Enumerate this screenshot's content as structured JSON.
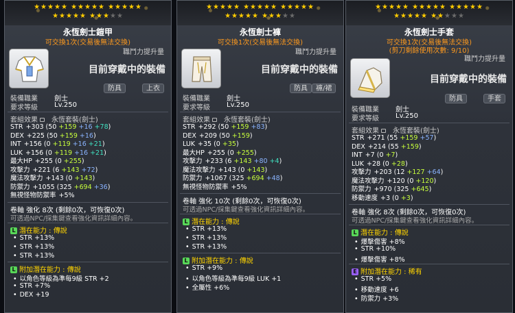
{
  "colors": {
    "tradable": "#ff9a1e",
    "starsOn": "#ffcc00",
    "green": "#c8ff3c",
    "blue": "#8ab4ff",
    "cyan": "#40e0c0",
    "legendary": "#58d858",
    "unique": "#ffcc00",
    "epic": "#9a60ff"
  },
  "items": [
    {
      "stars_row1": "★★★★★ ★★★★★ ★★★★★",
      "stars_row2": "★★★★★ ★★★",
      "stars_row2_dim": "★★",
      "title": "永恆劍士鎧甲",
      "tradable": "可交換1次(交易後無法交換)",
      "tradable2": "",
      "upgrade": "職鬥力提升量",
      "equipped": "目前穿戴中的裝備",
      "tags": [
        "防具",
        "上衣"
      ],
      "icon": "overall-armor-icon",
      "req_job_label": "裝備職業",
      "req_job": "劍士",
      "req_level_label": "要求等級",
      "req_level": "Lv.250",
      "set_label": "套組效果",
      "set_name": "永恆套裝(劍士)",
      "stats": [
        [
          "STR",
          "+303",
          " (50 ",
          "+159",
          " +16",
          " +78",
          ")"
        ],
        [
          "DEX",
          "+225",
          " (50 ",
          "+159",
          " +16",
          "",
          ")"
        ],
        [
          "INT",
          "+156",
          " (0 ",
          "+119",
          " +16",
          " +21",
          ")"
        ],
        [
          "LUK",
          "+156",
          " (0 ",
          "+119",
          " +16",
          " +21",
          ")"
        ],
        [
          "最大HP",
          "+255",
          " (0 ",
          "+255",
          "",
          "",
          ")"
        ],
        [
          "攻擊力",
          "+221",
          " (6 ",
          "+143",
          " +72",
          "",
          ")"
        ],
        [
          "魔法攻擊力",
          "+143",
          " (0 ",
          "+143",
          "",
          "",
          ")"
        ],
        [
          "防禦力",
          "+1055",
          " (325 ",
          "+694",
          " +36",
          "",
          ")"
        ],
        [
          "無視怪物防禦率",
          "+5%",
          "",
          "",
          "",
          "",
          ""
        ]
      ],
      "scroll": "卷軸 強化 8次 (剩餘0次，可恢復0次)",
      "npc": "可透過NPC/採集鍵查看強化資訊詳細內容。",
      "pot_label": "潛在能力 : 傳說",
      "pot_lines": [
        "STR +13%",
        "STR +13%",
        "STR +13%"
      ],
      "apot_label": "附加潛在能力 : 傳說",
      "apot_lines": [
        "以角色等級為準每9級 STR +2",
        "STR +7%",
        "DEX +19"
      ]
    },
    {
      "stars_row1": "★★★★★ ★★★★★ ★★★★★",
      "stars_row2": "★★★★★ ★★★",
      "stars_row2_dim": "★★",
      "title": "永恆劍士褲",
      "tradable": "可交換1次(交易後無法交換)",
      "tradable2": "",
      "upgrade": "職鬥力提升量",
      "equipped": "目前穿戴中的裝備",
      "tags": [
        "防具",
        "褲/裙"
      ],
      "icon": "pants-icon",
      "req_job_label": "裝備職業",
      "req_job": "劍士",
      "req_level_label": "要求等級",
      "req_level": "Lv.250",
      "set_label": "套組效果",
      "set_name": "永恆套裝(劍士)",
      "stats": [
        [
          "STR",
          "+292",
          " (50 ",
          "+159",
          " +83",
          "",
          ")"
        ],
        [
          "DEX",
          "+209",
          " (50 ",
          "+159",
          "",
          "",
          ")"
        ],
        [
          "LUK",
          "+35",
          " (0 ",
          "+35",
          "",
          "",
          ")"
        ],
        [
          "最大HP",
          "+255",
          " (0 ",
          "+255",
          "",
          "",
          ")"
        ],
        [
          "攻擊力",
          "+233",
          " (6 ",
          "+143",
          " +80",
          " +4",
          ")"
        ],
        [
          "魔法攻擊力",
          "+143",
          " (0 ",
          "+143",
          "",
          "",
          ")"
        ],
        [
          "防禦力",
          "+1067",
          " (325 ",
          "+694",
          " +48",
          "",
          ")"
        ],
        [
          "無視怪物防禦率",
          "+5%",
          "",
          "",
          "",
          "",
          ""
        ]
      ],
      "scroll": "卷軸 強化 10次 (剩餘0次，可恢復0次)",
      "npc": "可透過NPC/採集鍵查看強化資訊詳細內容。",
      "pot_label": "潛在能力 : 傳說",
      "pot_lines": [
        "STR +13%",
        "STR +13%",
        "STR +13%"
      ],
      "apot_label": "附加潛在能力 : 傳說",
      "apot_lines": [
        "STR +9%",
        "以角色等級為準每9級 LUK +1",
        "全屬性 +6%"
      ]
    },
    {
      "stars_row1": "★★★★★ ★★★★★ ★★★★★",
      "stars_row2": "★★★★★ ★★",
      "stars_row2_dim": "★★★",
      "title": "永恆劍士手套",
      "tradable": "可交換1次(交易後無法交換)",
      "tradable2": "(剪刀剩餘使用次數: 9/10)",
      "upgrade": "職鬥力提升量",
      "equipped": "目前穿戴中的裝備",
      "tags": [
        "防具",
        "手套"
      ],
      "icon": "glove-icon",
      "req_job_label": "裝備職業",
      "req_job": "劍士",
      "req_level_label": "要求等級",
      "req_level": "Lv.250",
      "set_label": "套組效果",
      "set_name": "永恆套裝(劍士)",
      "stats": [
        [
          "STR",
          "+271",
          " (55 ",
          "+159",
          " +57",
          "",
          ")"
        ],
        [
          "DEX",
          "+214",
          " (55 ",
          "+159",
          "",
          "",
          ")"
        ],
        [
          "INT",
          "+7",
          " (0 ",
          "+7",
          "",
          "",
          ")"
        ],
        [
          "LUK",
          "+28",
          " (0 ",
          "+28",
          "",
          "",
          ")"
        ],
        [
          "攻擊力",
          "+203",
          " (12 ",
          "+127",
          " +64",
          "",
          ")"
        ],
        [
          "魔法攻擊力",
          "+120",
          " (0 ",
          "+120",
          "",
          "",
          ")"
        ],
        [
          "防禦力",
          "+970",
          " (325 ",
          "+645",
          "",
          "",
          ")"
        ],
        [
          "移動速度",
          "+3",
          " (0 ",
          "+3",
          "",
          "",
          ")"
        ]
      ],
      "scroll": "卷軸 強化 8次 (剩餘0次，可恢復0次)",
      "npc": "可透過NPC/採集鍵查看強化資訊詳細內容。",
      "pot_label": "潛在能力 : 傳說",
      "pot_lines": [
        "爆擊傷害 +8%",
        "STR +10%",
        "爆擊傷害 +8%"
      ],
      "apot_label": "附加潛在能力 : 稀有",
      "apot_lines": [
        "STR +5%",
        "移動速度 +6",
        "防禦力 +3%"
      ]
    }
  ]
}
